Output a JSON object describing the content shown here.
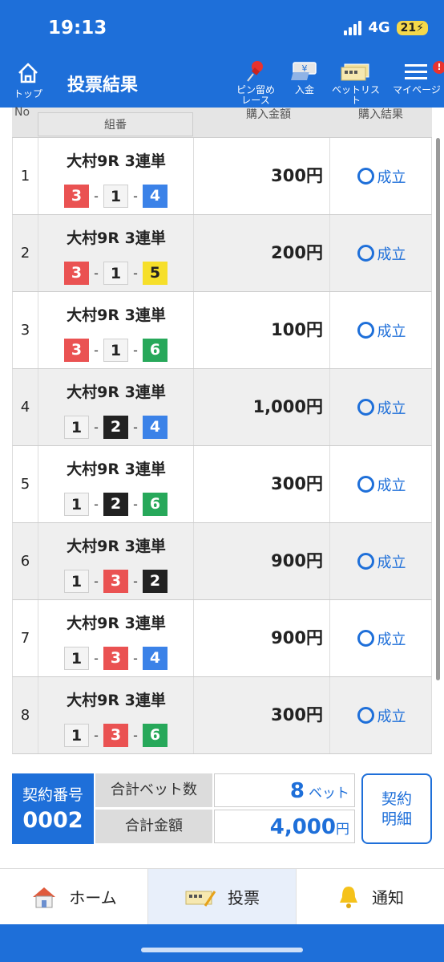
{
  "status": {
    "time": "19:13",
    "network": "4G",
    "battery": "21"
  },
  "header": {
    "top_label": "トップ",
    "title": "投票結果",
    "pin_label_1": "ピン留め",
    "pin_label_2": "レース",
    "deposit_label": "入金",
    "betlist_label": "ベットリスト",
    "mypage_label": "マイページ",
    "deposit_icon_char": "¥",
    "mypage_badge": "!"
  },
  "table": {
    "headers": {
      "no": "No",
      "combo": "組番",
      "amount": "購入金額",
      "result": "購入結果"
    },
    "rows": [
      {
        "no": "1",
        "race": "大村9R 3連単",
        "combo": [
          "3",
          "1",
          "4"
        ],
        "colors": [
          "red",
          "white",
          "blue"
        ],
        "amount": "300円",
        "result": "成立"
      },
      {
        "no": "2",
        "race": "大村9R 3連単",
        "combo": [
          "3",
          "1",
          "5"
        ],
        "colors": [
          "red",
          "white",
          "yellow"
        ],
        "amount": "200円",
        "result": "成立"
      },
      {
        "no": "3",
        "race": "大村9R 3連単",
        "combo": [
          "3",
          "1",
          "6"
        ],
        "colors": [
          "red",
          "white",
          "green"
        ],
        "amount": "100円",
        "result": "成立"
      },
      {
        "no": "4",
        "race": "大村9R 3連単",
        "combo": [
          "1",
          "2",
          "4"
        ],
        "colors": [
          "white",
          "black",
          "blue"
        ],
        "amount": "1,000円",
        "result": "成立"
      },
      {
        "no": "5",
        "race": "大村9R 3連単",
        "combo": [
          "1",
          "2",
          "6"
        ],
        "colors": [
          "white",
          "black",
          "green"
        ],
        "amount": "300円",
        "result": "成立"
      },
      {
        "no": "6",
        "race": "大村9R 3連単",
        "combo": [
          "1",
          "3",
          "2"
        ],
        "colors": [
          "white",
          "red",
          "black"
        ],
        "amount": "900円",
        "result": "成立"
      },
      {
        "no": "7",
        "race": "大村9R 3連単",
        "combo": [
          "1",
          "3",
          "4"
        ],
        "colors": [
          "white",
          "red",
          "blue"
        ],
        "amount": "900円",
        "result": "成立"
      },
      {
        "no": "8",
        "race": "大村9R 3連単",
        "combo": [
          "1",
          "3",
          "6"
        ],
        "colors": [
          "white",
          "red",
          "green"
        ],
        "amount": "300円",
        "result": "成立"
      }
    ]
  },
  "summary": {
    "contract_label": "契約番号",
    "contract_number": "0002",
    "bet_count_label": "合計ベット数",
    "bet_count_value": "8",
    "bet_count_unit": "ベット",
    "total_label": "合計金額",
    "total_value": "4,000",
    "total_unit": "円",
    "detail_line1": "契約",
    "detail_line2": "明細"
  },
  "nav": {
    "home": "ホーム",
    "vote": "投票",
    "notify": "通知"
  },
  "colors": {
    "brand_blue": "#1e6fd9"
  }
}
